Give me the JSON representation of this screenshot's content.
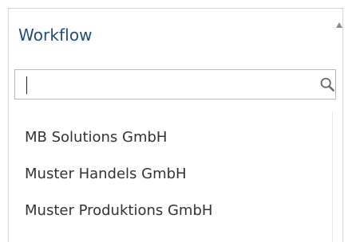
{
  "select": {
    "label": "Workflow",
    "caret_icon": "caret-up-icon"
  },
  "search": {
    "value": "",
    "placeholder": "",
    "icon": "search-icon"
  },
  "options": [
    {
      "label": "MB Solutions GmbH"
    },
    {
      "label": "Muster Handels GmbH"
    },
    {
      "label": "Muster Produktions GmbH"
    }
  ],
  "colors": {
    "label_text": "#1f4e79",
    "option_text": "#333333",
    "border": "#d6d6d6",
    "search_border": "#b9b9b9",
    "caret": "#8c8c8c"
  }
}
